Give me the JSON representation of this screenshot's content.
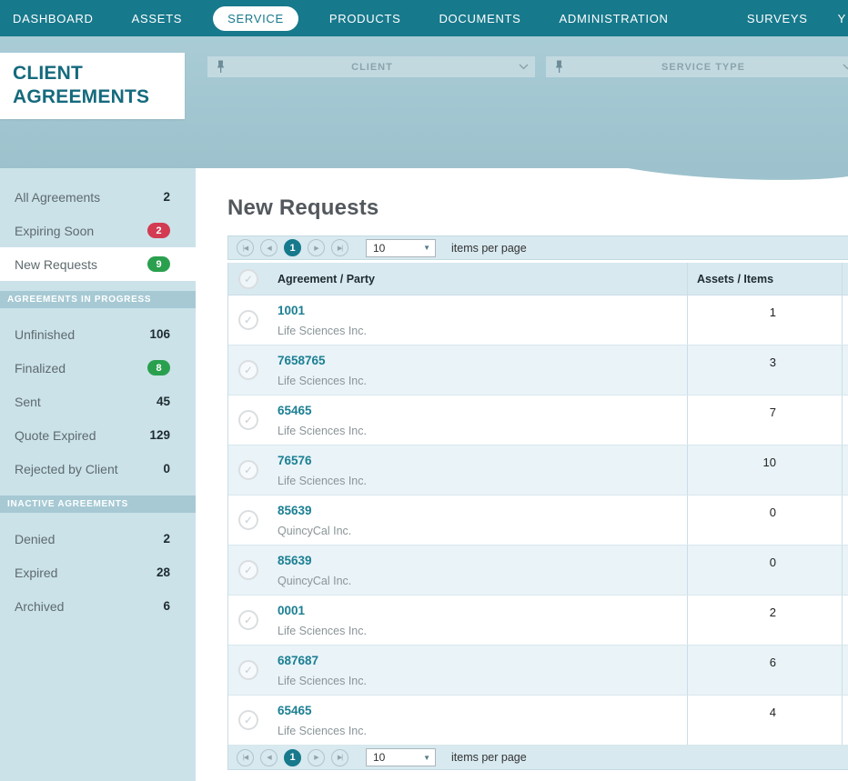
{
  "nav": {
    "items": [
      {
        "label": "DASHBOARD"
      },
      {
        "label": "ASSETS"
      },
      {
        "label": "SERVICE"
      },
      {
        "label": "PRODUCTS"
      },
      {
        "label": "DOCUMENTS"
      },
      {
        "label": "ADMINISTRATION"
      },
      {
        "label": "SURVEYS"
      },
      {
        "label": "Y"
      }
    ]
  },
  "header": {
    "page_title": "CLIENT AGREEMENTS",
    "filters": [
      {
        "label": "CLIENT"
      },
      {
        "label": "SERVICE TYPE"
      }
    ]
  },
  "sidebar": {
    "sections": [
      {
        "header": "",
        "items": [
          {
            "label": "All Agreements",
            "count": "2"
          },
          {
            "label": "Expiring Soon",
            "count": "2"
          },
          {
            "label": "New Requests",
            "count": "9"
          }
        ]
      },
      {
        "header": "AGREEMENTS IN PROGRESS",
        "items": [
          {
            "label": "Unfinished",
            "count": "106"
          },
          {
            "label": "Finalized",
            "count": "8"
          },
          {
            "label": "Sent",
            "count": "45"
          },
          {
            "label": "Quote Expired",
            "count": "129"
          },
          {
            "label": "Rejected by Client",
            "count": "0"
          }
        ]
      },
      {
        "header": "INACTIVE AGREEMENTS",
        "items": [
          {
            "label": "Denied",
            "count": "2"
          },
          {
            "label": "Expired",
            "count": "28"
          },
          {
            "label": "Archived",
            "count": "6"
          }
        ]
      }
    ]
  },
  "main": {
    "title": "New Requests",
    "pager": {
      "page": "1",
      "page_size": "10",
      "items_per_page_label": "items per page",
      "first": "|◀",
      "prev": "◀",
      "next": "▶",
      "last": "▶|"
    },
    "table": {
      "columns": [
        "Agreement / Party",
        "Assets / Items"
      ],
      "rows": [
        {
          "agreement": "1001",
          "party": "Life Sciences Inc.",
          "assets": "1"
        },
        {
          "agreement": "7658765",
          "party": "Life Sciences Inc.",
          "assets": "3"
        },
        {
          "agreement": "65465",
          "party": "Life Sciences Inc.",
          "assets": "7"
        },
        {
          "agreement": "76576",
          "party": "Life Sciences Inc.",
          "assets": "10"
        },
        {
          "agreement": "85639",
          "party": "QuincyCal Inc.",
          "assets": "0"
        },
        {
          "agreement": "85639",
          "party": "QuincyCal Inc.",
          "assets": "0"
        },
        {
          "agreement": "0001",
          "party": "Life Sciences Inc.",
          "assets": "2"
        },
        {
          "agreement": "687687",
          "party": "Life Sciences Inc.",
          "assets": "6"
        },
        {
          "agreement": "65465",
          "party": "Life Sciences Inc.",
          "assets": "4"
        }
      ]
    }
  },
  "colors": {
    "nav_teal": "#17798C",
    "band_blue": "#A3C6D1",
    "sidebar_blue": "#CBE2E9",
    "badge_red": "#D23B52",
    "badge_green": "#2AA04F",
    "link_teal": "#1B7F92",
    "grid_header_blue": "#D8E9F0",
    "row_alt_blue": "#E9F3F8"
  }
}
